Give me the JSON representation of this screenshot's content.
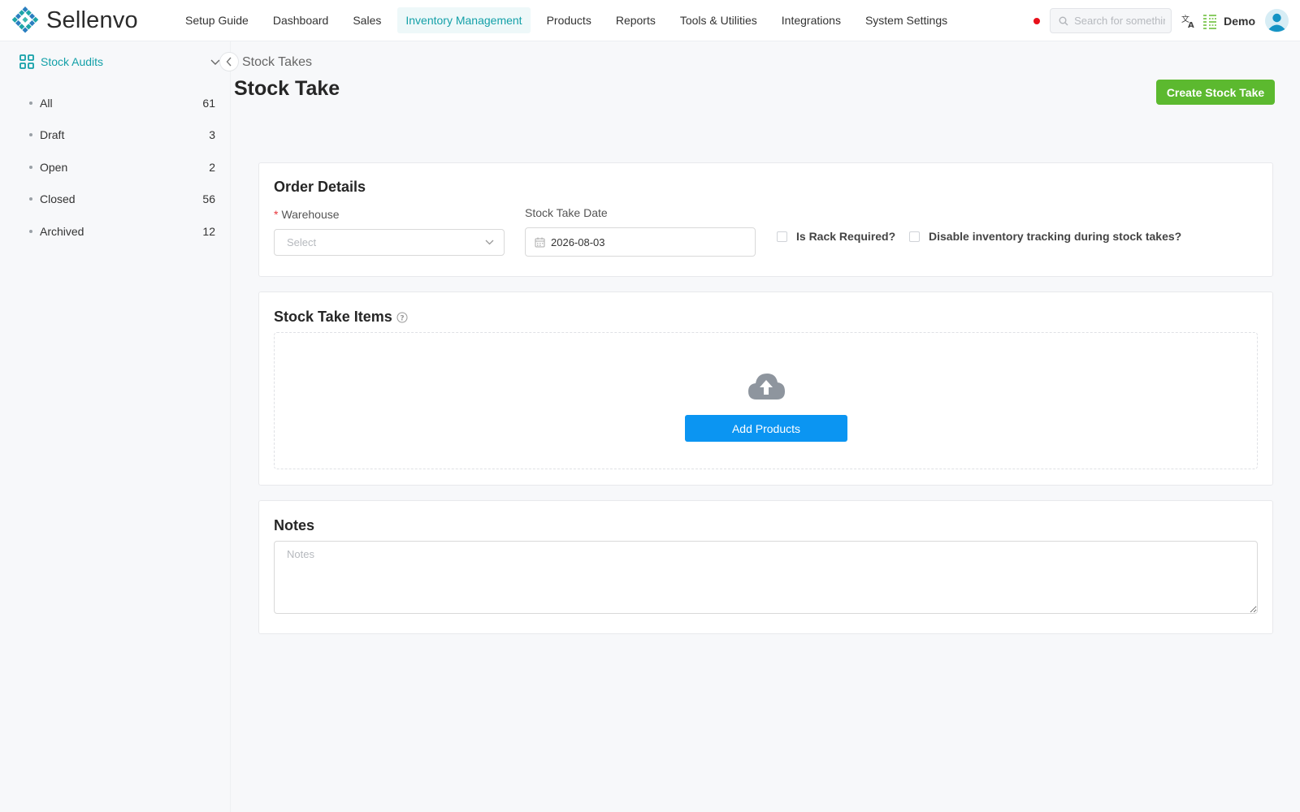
{
  "app": {
    "name": "Sellenvo",
    "brand_color": "#13a0a8"
  },
  "nav": {
    "items": [
      {
        "label": "Setup Guide"
      },
      {
        "label": "Dashboard"
      },
      {
        "label": "Sales"
      },
      {
        "label": "Inventory Management",
        "active": true
      },
      {
        "label": "Products"
      },
      {
        "label": "Reports"
      },
      {
        "label": "Tools & Utilities"
      },
      {
        "label": "Integrations"
      },
      {
        "label": "System Settings"
      }
    ],
    "search_placeholder": "Search for something",
    "user_name": "Demo",
    "icons": [
      "record-dot-icon",
      "search-icon",
      "translate-icon",
      "list-view-icon",
      "user-avatar-icon"
    ]
  },
  "sidebar": {
    "section_label": "Stock Audits",
    "items": [
      {
        "label": "All",
        "count": "61"
      },
      {
        "label": "Draft",
        "count": "3"
      },
      {
        "label": "Open",
        "count": "2"
      },
      {
        "label": "Closed",
        "count": "56"
      },
      {
        "label": "Archived",
        "count": "12"
      }
    ]
  },
  "page": {
    "breadcrumb": "Stock Takes",
    "title": "Stock Take",
    "create_button": "Create Stock Take",
    "create_color": "#5cb92f"
  },
  "order_details": {
    "title": "Order Details",
    "warehouse_required_mark": "*",
    "warehouse_label": "Warehouse",
    "warehouse_placeholder": "Select",
    "date_label": "Stock Take Date",
    "date_value": "2026-08-03",
    "rack_required_label": "Is Rack Required?",
    "rack_required_checked": false,
    "disable_tracking_label": "Disable inventory tracking during stock takes?",
    "disable_tracking_checked": false
  },
  "items_section": {
    "title": "Stock Take Items",
    "add_button": "Add Products",
    "add_color": "#0b95f2"
  },
  "notes_section": {
    "title": "Notes",
    "placeholder": "Notes"
  }
}
